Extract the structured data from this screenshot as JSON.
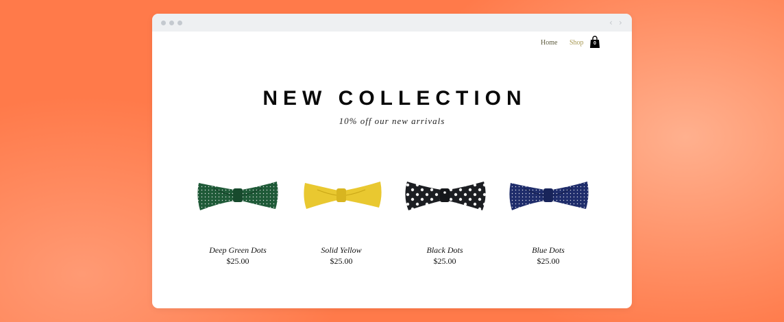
{
  "nav": {
    "home_label": "Home",
    "shop_label": "Shop",
    "cart_count": "0"
  },
  "colors": {
    "background": "#ff7a4a",
    "nav_home": "#5c5a3c",
    "nav_shop": "#a89a55",
    "green_tie": "#1f5a38",
    "yellow_tie": "#e9c830",
    "black_tie": "#1c1e22",
    "blue_tie": "#1f2d6b"
  },
  "hero": {
    "title": "NEW COLLECTION",
    "subtitle": "10% off our new arrivals"
  },
  "products": [
    {
      "name": "Deep Green Dots",
      "price": "$25.00",
      "icon": "bow-tie-green-dots"
    },
    {
      "name": "Solid Yellow",
      "price": "$25.00",
      "icon": "bow-tie-yellow"
    },
    {
      "name": "Black Dots",
      "price": "$25.00",
      "icon": "bow-tie-black-dots"
    },
    {
      "name": "Blue Dots",
      "price": "$25.00",
      "icon": "bow-tie-blue-dots"
    }
  ]
}
